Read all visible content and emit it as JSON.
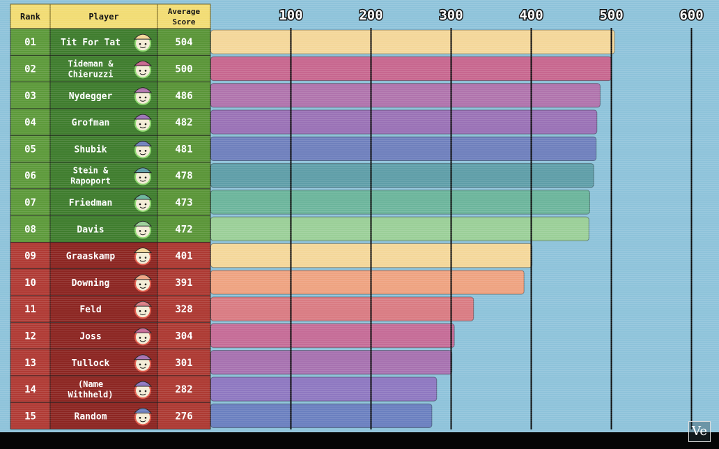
{
  "chart_data": {
    "type": "bar",
    "orientation": "horizontal",
    "xlim": [
      0,
      600
    ],
    "xticks": [
      100,
      200,
      300,
      400,
      500,
      600
    ],
    "grid": true,
    "headers": {
      "rank": "Rank",
      "player": "Player",
      "score_line1": "Average",
      "score_line2": "Score"
    },
    "rows": [
      {
        "rank": "01",
        "player": [
          "Tit For Tat"
        ],
        "value": 504,
        "group": "nice",
        "bar_color": "#f4d79a",
        "hat": "beanie-blue-icon"
      },
      {
        "rank": "02",
        "player": [
          "Tideman &",
          "Chieruzzi"
        ],
        "value": 500,
        "group": "nice",
        "bar_color": "#c7678f",
        "hat": "hard-hat-icon"
      },
      {
        "rank": "03",
        "player": [
          "Nydegger"
        ],
        "value": 486,
        "group": "nice",
        "bar_color": "#b074ad",
        "hat": "beard-icon"
      },
      {
        "rank": "04",
        "player": [
          "Grofman"
        ],
        "value": 482,
        "group": "nice",
        "bar_color": "#9a72b6",
        "hat": "beanie-maroon-icon"
      },
      {
        "rank": "05",
        "player": [
          "Shubik"
        ],
        "value": 481,
        "group": "nice",
        "bar_color": "#6f80bd",
        "hat": "party-hat-icon"
      },
      {
        "rank": "06",
        "player": [
          "Stein &",
          "Rapoport"
        ],
        "value": 478,
        "group": "nice",
        "bar_color": "#5f9ea8",
        "hat": "bowler-hat-icon"
      },
      {
        "rank": "07",
        "player": [
          "Friedman"
        ],
        "value": 473,
        "group": "nice",
        "bar_color": "#6cb59c",
        "hat": "cowboy-hat-icon"
      },
      {
        "rank": "08",
        "player": [
          "Davis"
        ],
        "value": 472,
        "group": "nice",
        "bar_color": "#9bcf98",
        "hat": "fedora-icon"
      },
      {
        "rank": "09",
        "player": [
          "Graaskamp"
        ],
        "value": 401,
        "group": "nasty",
        "bar_color": "#f4d79a",
        "hat": "mustache-glasses-icon"
      },
      {
        "rank": "10",
        "player": [
          "Downing"
        ],
        "value": 391,
        "group": "nasty",
        "bar_color": "#eea381",
        "hat": "top-hat-icon"
      },
      {
        "rank": "11",
        "player": [
          "Feld"
        ],
        "value": 328,
        "group": "nasty",
        "bar_color": "#d97c83",
        "hat": "cap-icon"
      },
      {
        "rank": "12",
        "player": [
          "Joss"
        ],
        "value": 304,
        "group": "nasty",
        "bar_color": "#c56c97",
        "hat": "sunglasses-icon"
      },
      {
        "rank": "13",
        "player": [
          "Tullock"
        ],
        "value": 301,
        "group": "nasty",
        "bar_color": "#a772b0",
        "hat": "tall-hat-icon"
      },
      {
        "rank": "14",
        "player": [
          "(Name",
          "Withheld)"
        ],
        "value": 282,
        "group": "nasty",
        "bar_color": "#8e78c1",
        "hat": "conical-hat-icon"
      },
      {
        "rank": "15",
        "player": [
          "Random"
        ],
        "value": 276,
        "group": "nasty",
        "bar_color": "#6b80c0",
        "hat": "jester-hat-icon"
      }
    ],
    "colors": {
      "header_bg": "#f2dc74",
      "nice_rank": "#5d9a3b",
      "nice_player": "#3f7d2e",
      "nice_score": "#5a9538",
      "nasty_rank": "#b03b35",
      "nasty_player": "#8c2622",
      "nasty_score": "#ad3a33",
      "background": "#8ec3da",
      "gridline": "#0a0a0a"
    }
  },
  "watermark": "Ve"
}
